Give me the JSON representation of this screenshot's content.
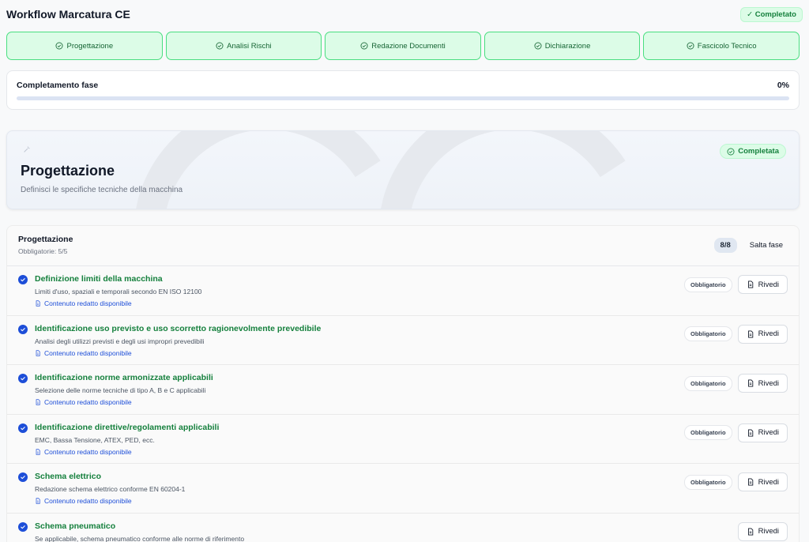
{
  "header": {
    "title": "Workflow Marcatura CE",
    "status_badge": "✓ Completato"
  },
  "steps": [
    {
      "label": "Progettazione"
    },
    {
      "label": "Analisi Rischi"
    },
    {
      "label": "Redazione Documenti"
    },
    {
      "label": "Dichiarazione"
    },
    {
      "label": "Fascicolo Tecnico"
    }
  ],
  "progress": {
    "label": "Completamento fase",
    "percent_text": "0%",
    "value": 0
  },
  "phase": {
    "title": "Progettazione",
    "description": "Definisci le specifiche tecniche della macchina",
    "badge": "Completata",
    "icon": "wrench-icon"
  },
  "tasks_section": {
    "title": "Progettazione",
    "subtitle": "Obbligatorie: 5/5",
    "count": "8/8",
    "skip_label": "Salta fase"
  },
  "tasks": [
    {
      "title": "Definizione limiti della macchina",
      "desc": "Limiti d'uso, spaziali e temporali secondo EN ISO 12100",
      "link": "Contenuto redatto disponibile",
      "required": "Obbligatorio",
      "action": "Rivedi"
    },
    {
      "title": "Identificazione uso previsto e uso scorretto ragionevolmente prevedibile",
      "desc": "Analisi degli utilizzi previsti e degli usi impropri prevedibili",
      "link": "Contenuto redatto disponibile",
      "required": "Obbligatorio",
      "action": "Rivedi"
    },
    {
      "title": "Identificazione norme armonizzate applicabili",
      "desc": "Selezione delle norme tecniche di tipo A, B e C applicabili",
      "link": "Contenuto redatto disponibile",
      "required": "Obbligatorio",
      "action": "Rivedi"
    },
    {
      "title": "Identificazione direttive/regolamenti applicabili",
      "desc": "EMC, Bassa Tensione, ATEX, PED, ecc.",
      "link": "Contenuto redatto disponibile",
      "required": "Obbligatorio",
      "action": "Rivedi"
    },
    {
      "title": "Schema elettrico",
      "desc": "Redazione schema elettrico conforme EN 60204-1",
      "link": "Contenuto redatto disponibile",
      "required": "Obbligatorio",
      "action": "Rivedi"
    },
    {
      "title": "Schema pneumatico",
      "desc": "Se applicabile, schema pneumatico conforme alle norme di riferimento",
      "link": "",
      "required": "",
      "action": "Rivedi"
    }
  ],
  "colors": {
    "accent_green": "#15803d",
    "accent_blue": "#1d4ed8",
    "step_bg": "#dcfce7",
    "step_border": "#4ade80"
  }
}
